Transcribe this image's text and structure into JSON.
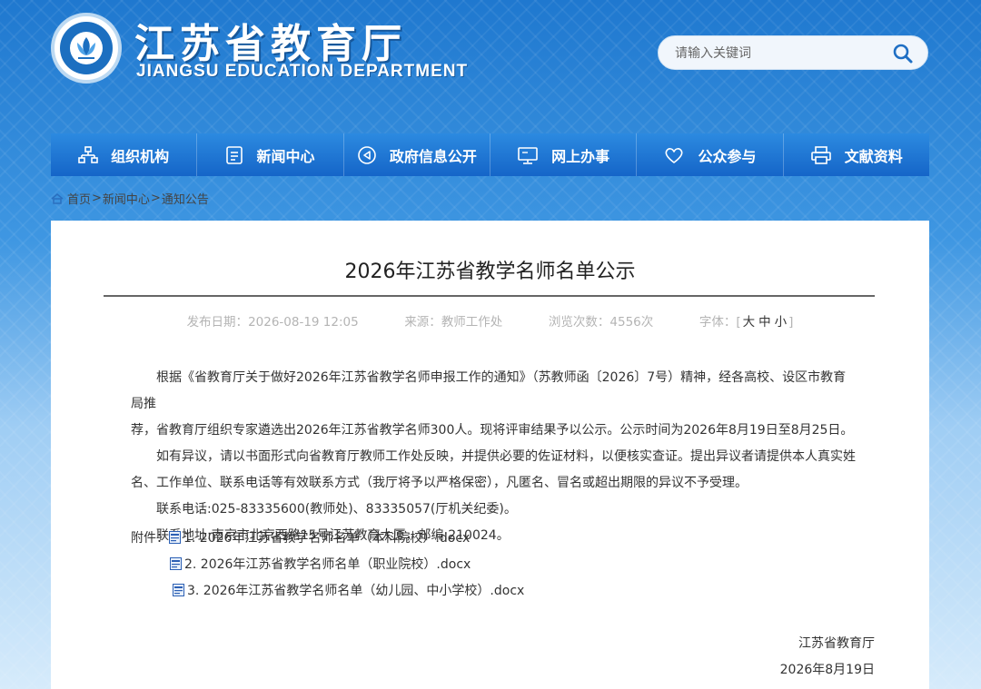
{
  "header": {
    "title": "江苏省教育厅",
    "subtitle": "JIANGSU EDUCATION DEPARTMENT",
    "search_placeholder": "请输入关键词"
  },
  "nav": [
    {
      "label": "组织机构",
      "icon": "org-chart-icon"
    },
    {
      "label": "新闻中心",
      "icon": "document-icon"
    },
    {
      "label": "政府信息公开",
      "icon": "speaker-icon"
    },
    {
      "label": "网上办事",
      "icon": "monitor-icon"
    },
    {
      "label": "公众参与",
      "icon": "heart-icon"
    },
    {
      "label": "文献资料",
      "icon": "printer-icon"
    }
  ],
  "breadcrumb": {
    "home": "首页",
    "sep": ">",
    "items": [
      "新闻中心",
      "通知公告"
    ]
  },
  "article": {
    "title": "2026年江苏省教学名师名单公示",
    "meta": {
      "date_label": "发布日期：",
      "date": "2026-08-19 12:05",
      "source_label": "来源：",
      "source": "教师工作处",
      "views_label": "浏览次数：",
      "views": "4556次",
      "font_label": "字体：",
      "font_open": "[",
      "font_large": "大",
      "font_medium": "中",
      "font_small": "小",
      "font_close": "]"
    },
    "p1_line1": "根据《省教育厅关于做好2026年江苏省教学名师申报工作的通知》（苏教师函〔2026〕7号）精神，经各高校、设区市教育局推",
    "p1_line2": "荐，省教育厅组织专家遴选出2026年江苏省教学名师300人。现将评审结果予以公示。公示时间为2026年8月19日至8月25日。",
    "p2_line1": "如有异议，请以书面形式向省教育厅教师工作处反映，并提供必要的佐证材料，以便核实查证。提出异议者请提供本人真实姓",
    "p2_line2": "名、工作单位、联系电话等有效联系方式（我厅将予以严格保密），凡匿名、冒名或超出期限的异议不予受理。",
    "phone": "联系电话:025-83335600(教师处)、83335057(厅机关纪委)。",
    "address": "联系地址:南京市北京西路15号江苏教育大厦，邮编:210024。",
    "attach_label": "附件：",
    "attachments": [
      "1. 2026年江苏省教学名师名单（本科院校）.docx",
      "2. 2026年江苏省教学名师名单（职业院校）.docx",
      "3. 2026年江苏省教学名师名单（幼儿园、中小学校）.docx"
    ],
    "signature": "江苏省教育厅",
    "sign_date": "2026年8月19日"
  }
}
